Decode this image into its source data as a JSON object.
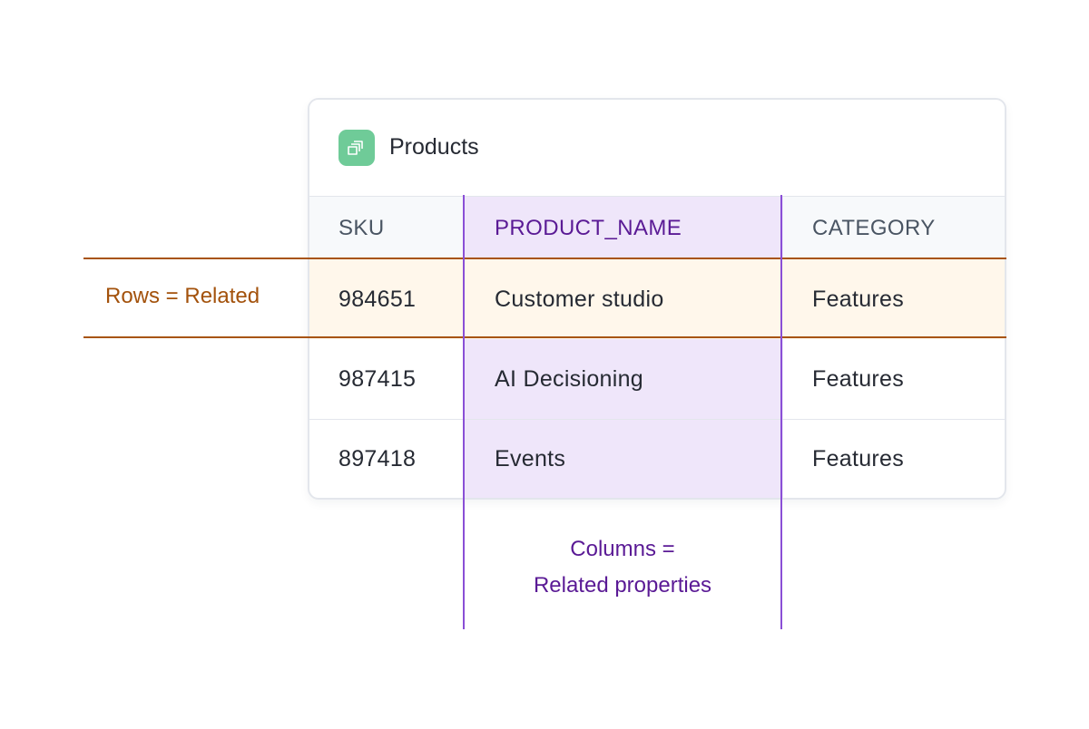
{
  "card": {
    "title": "Products",
    "icon": "stacked-layers-icon"
  },
  "table": {
    "columns": [
      "SKU",
      "PRODUCT_NAME",
      "CATEGORY"
    ],
    "rows": [
      [
        "984651",
        "Customer studio",
        "Features"
      ],
      [
        "987415",
        "AI Decisioning",
        "Features"
      ],
      [
        "897418",
        "Events",
        "Features"
      ]
    ]
  },
  "annotations": {
    "rows_label": "Rows = Related",
    "columns_label_line1": "Columns =",
    "columns_label_line2": "Related properties"
  },
  "colors": {
    "row_highlight": "#fff7eb",
    "row_line": "#a8540f",
    "column_highlight": "#efe6fa",
    "column_line": "#8a4fd6",
    "icon_bg": "#6fcb98"
  }
}
